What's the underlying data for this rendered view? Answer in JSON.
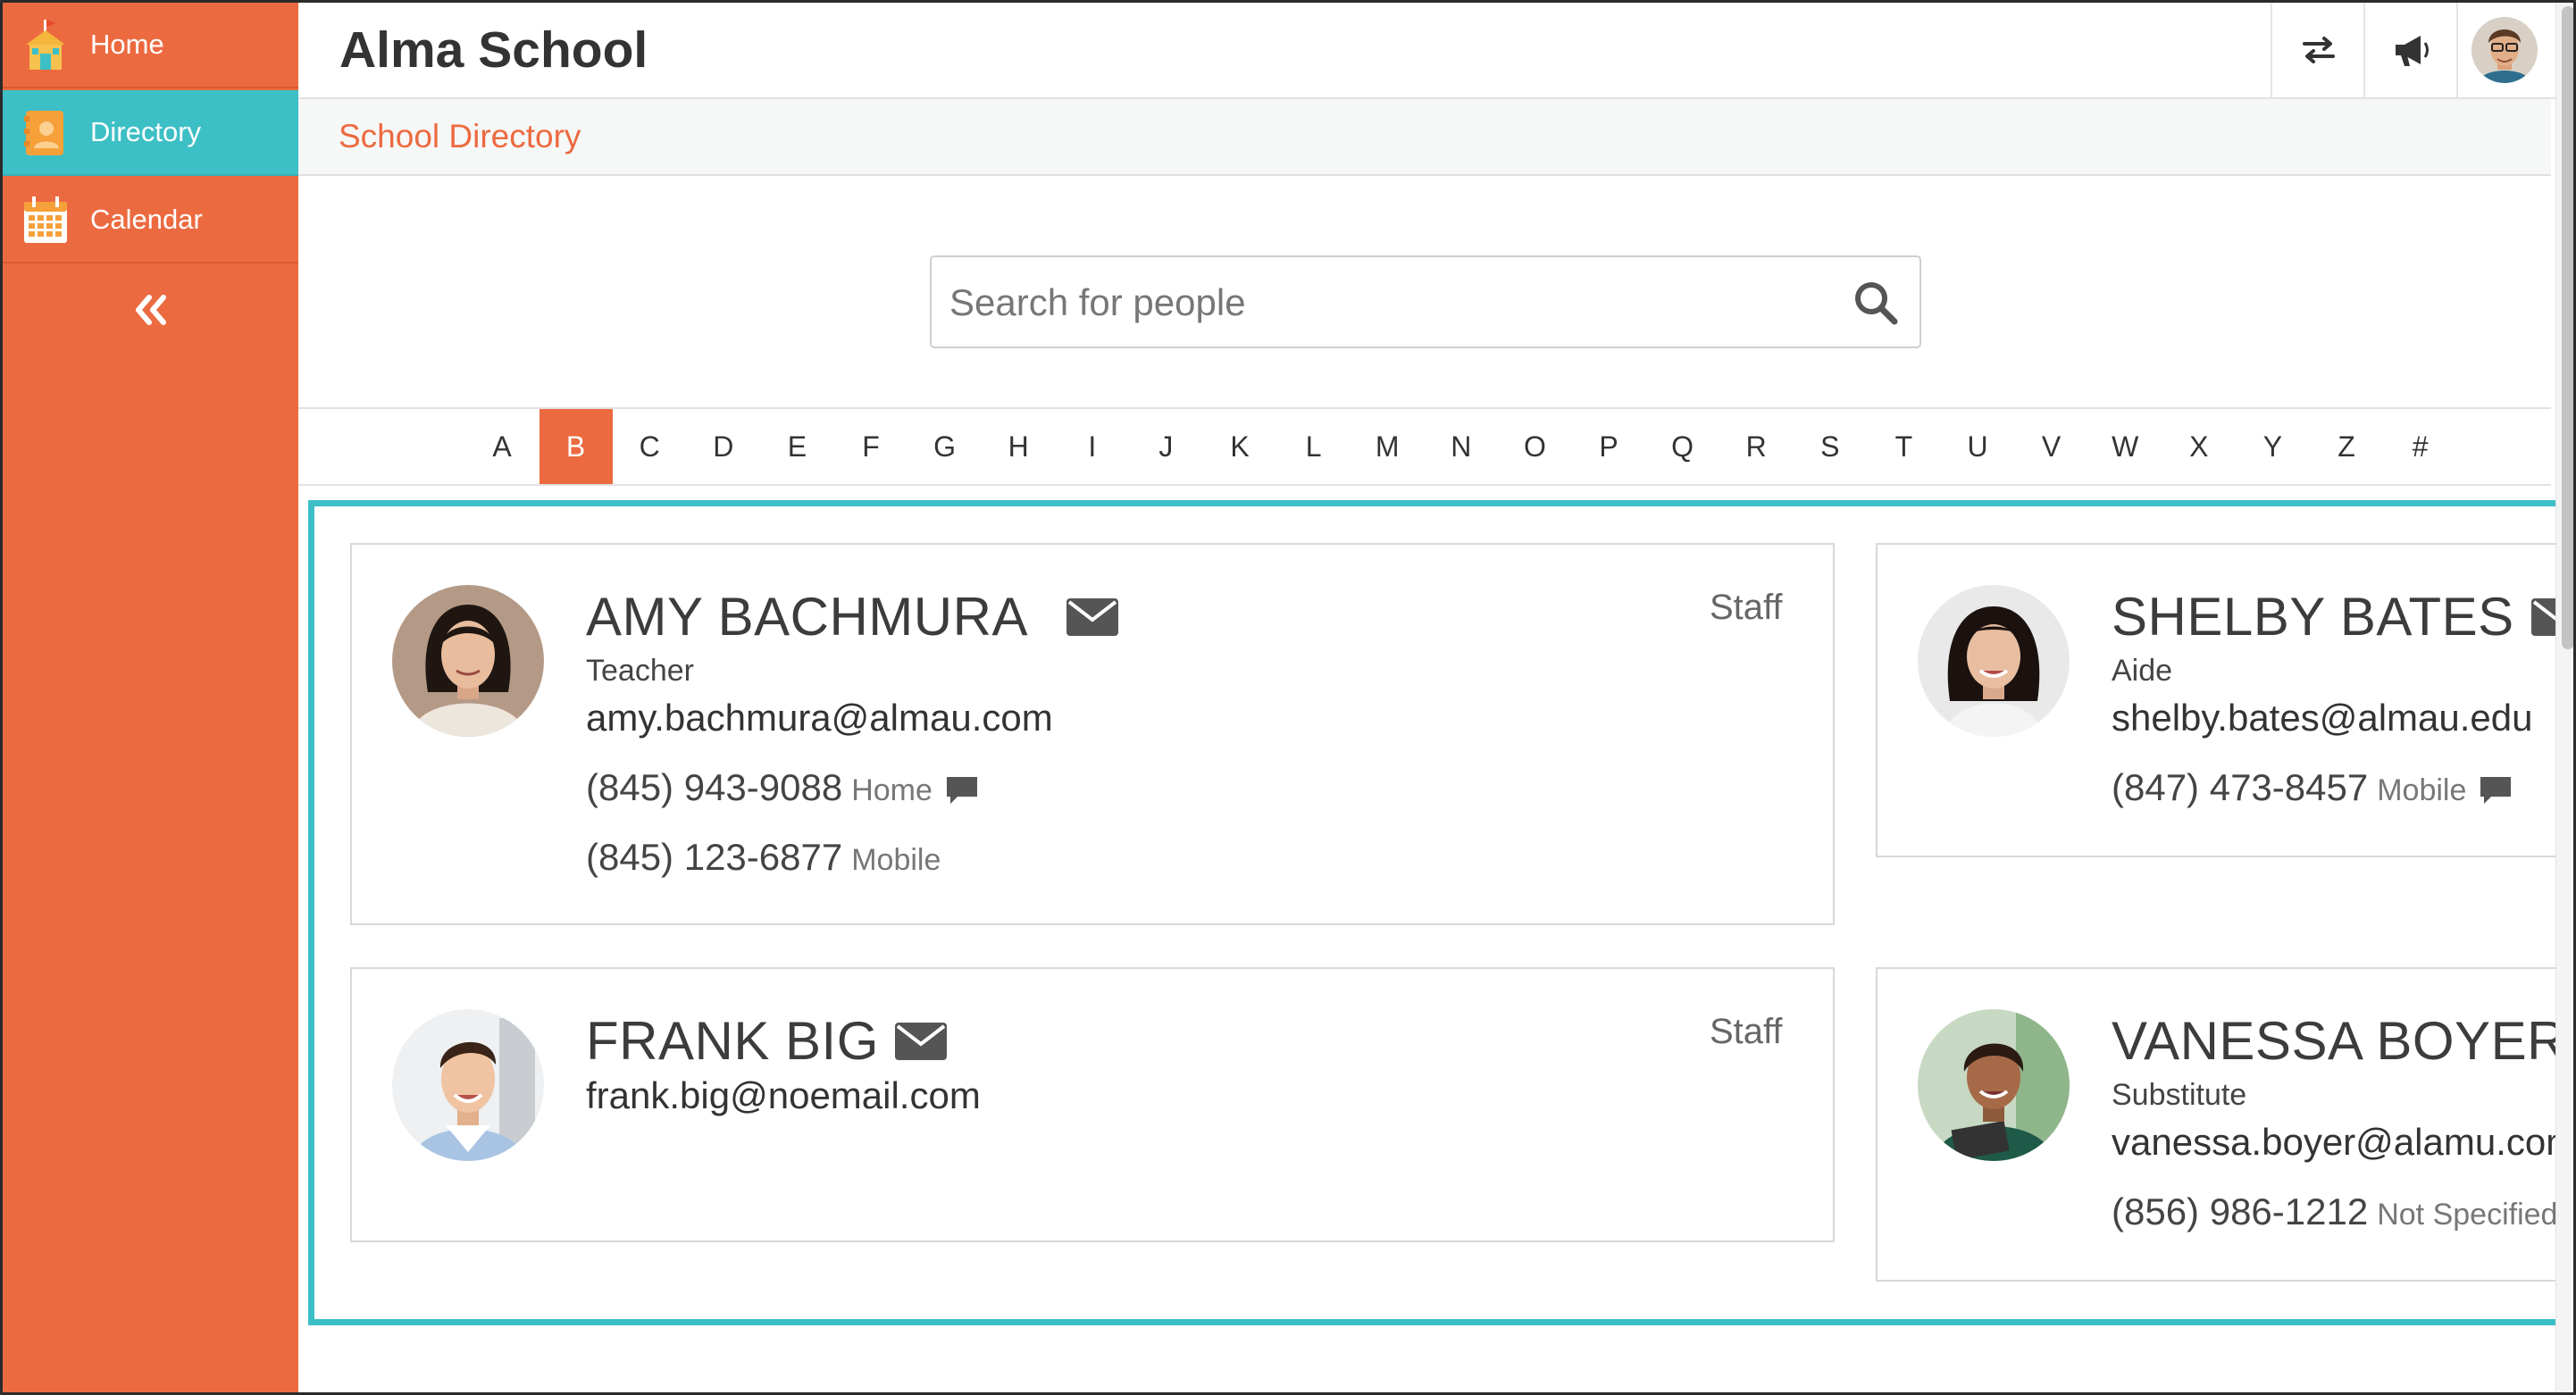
{
  "sidebar": {
    "items": [
      {
        "label": "Home",
        "icon": "school-house-icon"
      },
      {
        "label": "Directory",
        "icon": "directory-contact-icon",
        "active": true
      },
      {
        "label": "Calendar",
        "icon": "calendar-icon"
      }
    ],
    "collapse_icon": "double-chevron-left-icon"
  },
  "header": {
    "title": "Alma School",
    "icons": [
      "switch-arrows-icon",
      "megaphone-icon",
      "user-avatar"
    ]
  },
  "breadcrumb": "School Directory",
  "search": {
    "placeholder": "Search for people",
    "value": ""
  },
  "alphabet": {
    "letters": [
      "A",
      "B",
      "C",
      "D",
      "E",
      "F",
      "G",
      "H",
      "I",
      "J",
      "K",
      "L",
      "M",
      "N",
      "O",
      "P",
      "Q",
      "R",
      "S",
      "T",
      "U",
      "V",
      "W",
      "X",
      "Y",
      "Z",
      "#"
    ],
    "selected": "B"
  },
  "people": [
    {
      "name": "AMY BACHMURA",
      "role": "Teacher",
      "email": "amy.bachmura@almau.com",
      "category": "Staff",
      "phones": [
        {
          "number": "(845) 943-9088",
          "type": "Home",
          "sms": true
        },
        {
          "number": "(845) 123-6877",
          "type": "Mobile",
          "sms": false
        }
      ]
    },
    {
      "name": "SHELBY BATES",
      "role": "Aide",
      "email": "shelby.bates@almau.edu",
      "phones": [
        {
          "number": "(847) 473-8457",
          "type": "Mobile",
          "sms": true
        }
      ]
    },
    {
      "name": "FRANK BIG",
      "role": "",
      "email": "frank.big@noemail.com",
      "category": "Staff",
      "phones": []
    },
    {
      "name": "VANESSA BOYER",
      "role": "Substitute",
      "email": "vanessa.boyer@alamu.com",
      "phones": [
        {
          "number": "(856) 986-1212",
          "type": "Not Specified",
          "sms": false
        }
      ]
    }
  ],
  "colors": {
    "accent": "#ec6a40",
    "highlight": "#3dbfc6",
    "text": "#333333"
  }
}
